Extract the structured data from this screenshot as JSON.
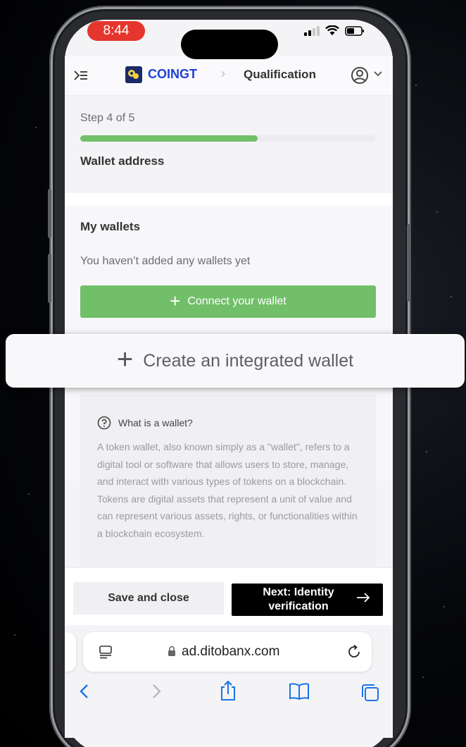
{
  "status_bar": {
    "time": "8:44"
  },
  "header": {
    "brand": "COINGT",
    "breadcrumb_separator": "›",
    "current_page": "Qualification"
  },
  "progress": {
    "step_text": "Step 4 of 5",
    "fraction": 0.6,
    "section_title": "Wallet address"
  },
  "wallets": {
    "title": "My wallets",
    "empty_text": "You haven’t added any wallets yet",
    "connect_label": "Connect your wallet"
  },
  "integrated_wallet": {
    "label": "Create an integrated wallet"
  },
  "info": {
    "title": "What is a wallet?",
    "body": "A token wallet, also known simply as a \"wallet\", refers to a digital tool or software that allows users to store, manage, and interact with various types of tokens on a blockchain. Tokens are digital assets that represent a unit of value and can represent various assets, rights, or functionalities within a blockchain ecosystem."
  },
  "footer": {
    "save_label": "Save and close",
    "next_label": "Next: Identity verification"
  },
  "browser": {
    "url": "ad.ditobanx.com"
  },
  "colors": {
    "accent_green": "#72bf6a",
    "brand_blue": "#1f3fd6",
    "recording_red": "#e5362e"
  },
  "icons": [
    "menu-icon",
    "logo-icon",
    "user-circle-icon",
    "chevron-down-icon",
    "plus-icon",
    "question-circle-icon",
    "arrow-right-icon",
    "reader-icon",
    "lock-icon",
    "reload-icon",
    "back-icon",
    "forward-icon",
    "share-icon",
    "bookmarks-icon",
    "tabs-icon"
  ]
}
